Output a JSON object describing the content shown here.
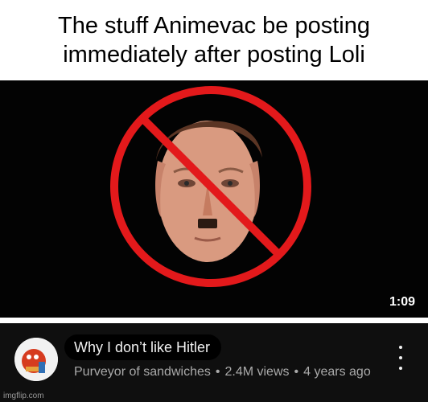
{
  "caption": {
    "line1": "The stuff Animevac be posting",
    "line2": "immediately after posting Loli"
  },
  "video": {
    "thumbnail_icon": "no-symbol-over-face",
    "duration": "1:09",
    "title": "Why I don’t like Hitler",
    "channel": "Purveyor of sandwiches",
    "views": "2.4M views",
    "age": "4 years ago",
    "separator": "•",
    "avatar_icon": "cartoon-character-avatar",
    "menu_icon": "more-vert-icon"
  },
  "watermark": "imgflip.com",
  "colors": {
    "caption_bg": "#ffffff",
    "thumb_bg": "#030303",
    "info_bg": "#0f0f0f",
    "prohibition_red": "#e3191b",
    "title_text": "#f1f1f1",
    "meta_text": "#aaaaaa"
  }
}
